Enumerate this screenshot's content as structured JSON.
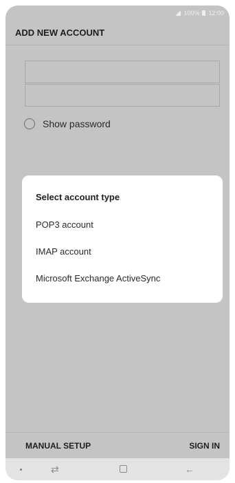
{
  "status_bar": {
    "battery_text": "100%",
    "time": "12:00",
    "icons": [
      "signal-icon",
      "battery-icon"
    ]
  },
  "header": {
    "title": "ADD NEW ACCOUNT"
  },
  "form": {
    "email_value": "",
    "password_value": "",
    "show_password_label": "Show password"
  },
  "dialog": {
    "title": "Select account type",
    "options": [
      "POP3 account",
      "IMAP account",
      "Microsoft Exchange ActiveSync"
    ]
  },
  "footer": {
    "manual_setup_label": "MANUAL SETUP",
    "sign_in_label": "SIGN IN"
  },
  "nav": {
    "icons": [
      "dot-icon",
      "recent-apps-icon",
      "home-icon",
      "back-icon"
    ]
  }
}
